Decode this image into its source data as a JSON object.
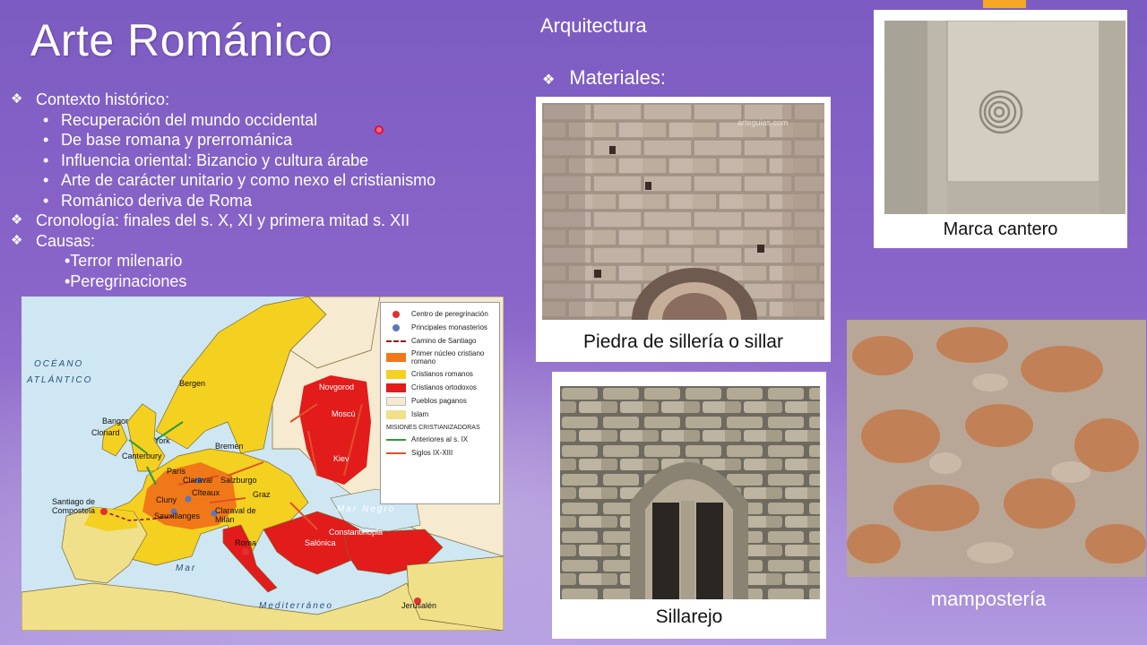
{
  "title": "Arte Románico",
  "context": {
    "heading": "Contexto histórico:",
    "items": [
      "Recuperación del mundo occidental",
      "De base romana y prerrománica",
      "Influencia oriental: Bizancio y cultura árabe",
      "Arte de carácter unitario y como nexo el  cristianismo",
      "Románico deriva de Roma"
    ],
    "chronology": "Cronología: finales del s. X, XI y primera mitad s. XII",
    "causes_heading": "Causas:",
    "causes": [
      "•Terror milenario",
      "•Peregrinaciones"
    ]
  },
  "architecture": {
    "title": "Arquitectura",
    "materials_label": "Materiales:"
  },
  "images": {
    "sillar_caption": "Piedra de sillería o sillar",
    "sillar_watermark": "arteguias.com",
    "cantero_caption": "Marca cantero",
    "sillarejo_caption": "Sillarejo",
    "mamposteria_caption": "mampostería"
  },
  "map": {
    "legend": [
      {
        "label": "Centro de peregrinación",
        "kind": "dot",
        "color": "#e03030"
      },
      {
        "label": "Principales monasterios",
        "kind": "dot",
        "color": "#5a78b8"
      },
      {
        "label": "Camino de Santiago",
        "kind": "dash",
        "color": "#a01010"
      },
      {
        "label": "Primer núcleo cristiano romano",
        "kind": "box",
        "color": "#f07818"
      },
      {
        "label": "Cristianos romanos",
        "kind": "box",
        "color": "#f4d020"
      },
      {
        "label": "Cristianos ortodoxos",
        "kind": "box",
        "color": "#e21b1b"
      },
      {
        "label": "Pueblos paganos",
        "kind": "box",
        "color": "#f6ead0"
      },
      {
        "label": "Islam",
        "kind": "box",
        "color": "#f0e08a"
      }
    ],
    "missions_heading": "MISIONES CRISTIANIZADORAS",
    "missions": [
      {
        "label": "Anteriores al s. IX",
        "color": "#2e9a3a"
      },
      {
        "label": "Siglos IX-XIII",
        "color": "#e0502a"
      }
    ],
    "seas": {
      "ocean1": "OCÉANO",
      "ocean2": "ATLÁNTICO",
      "mar": "Mar",
      "mediterraneo": "Mediterráneo",
      "marnegro": "Mar Negro"
    },
    "cities": {
      "bergen": "Bergen",
      "bangor": "Bangor",
      "clonard": "Clonard",
      "york": "York",
      "canterbury": "Canterbury",
      "bremen": "Bremen",
      "paris": "París",
      "claraval": "Claraval",
      "citeaux": "Cîteaux",
      "cluny": "Cluny",
      "sauxillanges": "Sauxillanges",
      "claravalmilan": "Claraval de Milán",
      "salzburgo": "Salzburgo",
      "graz": "Graz",
      "roma": "Roma",
      "santiago": "Santiago de Compostela",
      "novgorod": "Novgorod",
      "moscu": "Moscú",
      "kiev": "Kiev",
      "salonica": "Salónica",
      "constantinopla": "Constantinopla",
      "jerusalen": "Jerusalén"
    }
  }
}
